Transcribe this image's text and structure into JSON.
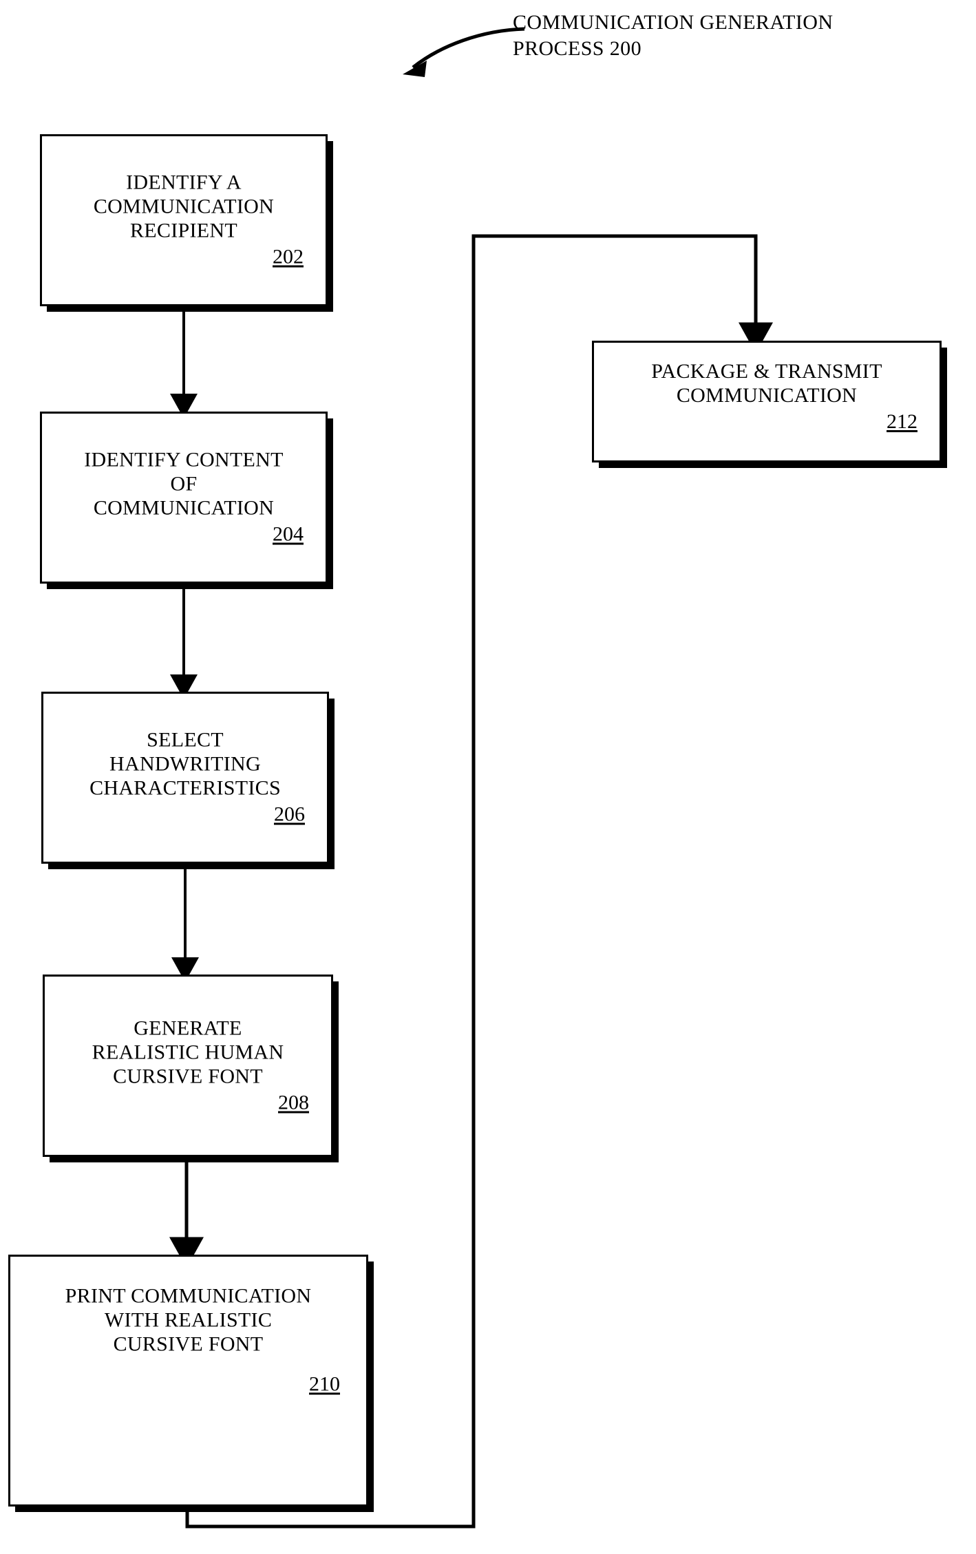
{
  "figure": {
    "title_line1": "COMMUNICATION GENERATION",
    "title_line2": "PROCESS 200",
    "title": "COMMUNICATION GENERATION\nPROCESS 200",
    "process_number": "200"
  },
  "nodes": [
    {
      "id": "202",
      "label": "IDENTIFY A\nCOMMUNICATION\nRECIPIENT",
      "ref": "202"
    },
    {
      "id": "204",
      "label": "IDENTIFY CONTENT\nOF\nCOMMUNICATION",
      "ref": "204"
    },
    {
      "id": "206",
      "label": "SELECT\nHANDWRITING\nCHARACTERISTICS",
      "ref": "206"
    },
    {
      "id": "208",
      "label": "GENERATE\nREALISTIC HUMAN\nCURSIVE FONT",
      "ref": "208"
    },
    {
      "id": "210",
      "label": "PRINT COMMUNICATION\nWITH REALISTIC\nCURSIVE FONT",
      "ref": "210"
    },
    {
      "id": "212",
      "label": "PACKAGE & TRANSMIT\nCOMMUNICATION",
      "ref": "212"
    }
  ],
  "connectors": [
    {
      "name": "arrow-202-to-204",
      "from": "202",
      "to": "204"
    },
    {
      "name": "arrow-204-to-206",
      "from": "204",
      "to": "206"
    },
    {
      "name": "arrow-206-to-208",
      "from": "206",
      "to": "208"
    },
    {
      "name": "arrow-208-to-210",
      "from": "208",
      "to": "210"
    },
    {
      "name": "arrow-210-to-212",
      "from": "210",
      "to": "212"
    },
    {
      "name": "callout-arrow-to-title",
      "from": "title",
      "to": "diagram"
    }
  ],
  "style": {
    "ink": "#000000",
    "paper": "#ffffff"
  }
}
